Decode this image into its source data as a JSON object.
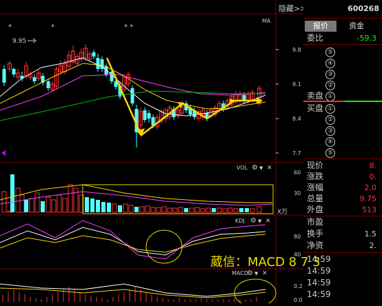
{
  "header": {
    "hide_label": "隐藏>>",
    "stock_code": "600268",
    "ma_label": "MA"
  },
  "tabs": [
    {
      "label": "报价",
      "active": true
    },
    {
      "label": "资金",
      "active": false
    }
  ],
  "quote": {
    "wei_bi_label": "委比",
    "wei_bi_value": "-59.3",
    "sell_label": "卖盘",
    "buy_label": "买盘",
    "sell_levels": [
      "⑤",
      "④",
      "③",
      "②",
      "①"
    ],
    "buy_levels": [
      "①",
      "②",
      "③",
      "④",
      "⑤"
    ]
  },
  "stats": [
    {
      "label": "现价",
      "value": "8."
    },
    {
      "label": "涨跌",
      "value": "0."
    },
    {
      "label": "涨幅",
      "value": "2.0"
    },
    {
      "label": "总量",
      "value": "9.75"
    },
    {
      "label": "外盘",
      "value": "513"
    }
  ],
  "stats2": [
    {
      "label": "市盈",
      "value": ""
    },
    {
      "label": "换手",
      "value": "1.5"
    },
    {
      "label": "净资",
      "value": "2."
    }
  ],
  "ticks": [
    "14:59",
    "14:59",
    "14:59",
    "14:59"
  ],
  "price_axis": [
    "9.8",
    "9.1",
    "8.4",
    "7.7"
  ],
  "price_marker": "9.95",
  "stars": [
    "*",
    "*",
    "* *"
  ],
  "vol_panel": {
    "label": "VOL",
    "unit": "X万",
    "axis": [
      "60",
      "30"
    ]
  },
  "kdj_panel": {
    "label": "KDJ",
    "axis": [
      "80",
      "40"
    ]
  },
  "macd_panel": {
    "label": "MACD",
    "axis": [
      "0.2",
      "0.0"
    ]
  },
  "watermark": "葳信：MACD 8 7 3",
  "colors": {
    "up": "#ff3232",
    "down": "#54ffff",
    "arrow": "#ffd700",
    "sell": "#ff3232",
    "buy": "#00ff00"
  }
}
